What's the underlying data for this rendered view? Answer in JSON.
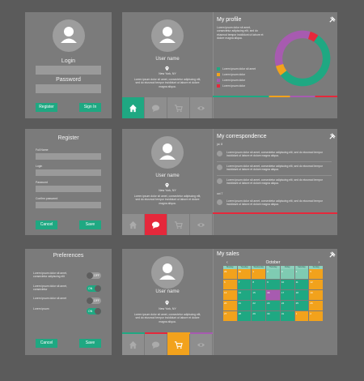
{
  "login": {
    "login_label": "Login",
    "password_label": "Password",
    "register_btn": "Register",
    "signin_btn": "Sign In"
  },
  "register": {
    "title": "Register",
    "fields": [
      "Full Name",
      "Login",
      "Password",
      "Confirm password"
    ],
    "cancel_btn": "Cancel",
    "save_btn": "Save"
  },
  "preferences": {
    "title": "Preferences",
    "items": [
      {
        "text": "Lorem ipsum dolor sit amet, consectetur adipiscing elit",
        "state": "OFF"
      },
      {
        "text": "Lorem ipsum dolor sit amet, consectetur",
        "state": "ON"
      },
      {
        "text": "Lorem ipsum dolor sit amet",
        "state": "OFF"
      },
      {
        "text": "Lorem ipsum",
        "state": "ON"
      }
    ],
    "cancel_btn": "Cancel",
    "save_btn": "Save"
  },
  "profile": {
    "title": "My profile",
    "intro": "Lorem ipsum dolor sit amet, consectetur adipiscing elit, sed do eiusmod tempor incididunt ut labore et dolore magna aliqua.",
    "legend": [
      {
        "label": "Lorem ipsum dolor sit amet",
        "color": "#1fa882"
      },
      {
        "label": "Lorem ipsum dolor",
        "color": "#f2a21c"
      },
      {
        "label": "Lorem ipsum dolor",
        "color": "#a75bb0"
      },
      {
        "label": "Lorem ipsum dolor",
        "color": "#e5283b"
      }
    ],
    "chart_values": [
      55,
      6,
      34,
      5
    ]
  },
  "user": {
    "name": "User name",
    "location": "New York, NY",
    "bio": "Lorem ipsum dolor sit amet, consectetur adipiscing elit, sed do eiusmod tempor incididunt ut labore et dolore magna aliqua."
  },
  "correspondence": {
    "title": "My correspondence",
    "date_top": "jul. 8",
    "date_bottom": "oct 7",
    "message": "Lorem ipsum dolor sit amet, consectetur adipiscing elit, sed do eiusmod tempor incididunt ut labore et dolore magna aliqua."
  },
  "sales": {
    "title": "My sales",
    "month": "October",
    "prev": "‹",
    "next": "›",
    "weekdays": [
      "Monday",
      "Tuesday",
      "Wednesday",
      "Thursday",
      "Friday",
      "Saturday",
      "Sunday"
    ],
    "days": [
      "29",
      "30",
      "1",
      "2",
      "3",
      "4",
      "5",
      "6",
      "7",
      "8",
      "9",
      "10",
      "11",
      "12",
      "13",
      "14",
      "15",
      "16",
      "17",
      "18",
      "19",
      "20",
      "21",
      "22",
      "23",
      "24",
      "25",
      "26",
      "27",
      "28",
      "29",
      "30",
      "31",
      "1",
      "2"
    ]
  },
  "colors": {
    "green": "#1fa882",
    "red": "#e5283b",
    "orange": "#f2a21c",
    "purple": "#a75bb0",
    "panel": "#7b7b7b"
  },
  "icons": [
    "user-icon",
    "home-icon",
    "chat-icon",
    "cart-icon",
    "eye-icon",
    "location-pin-icon",
    "tools-icon",
    "envelope-icon"
  ]
}
